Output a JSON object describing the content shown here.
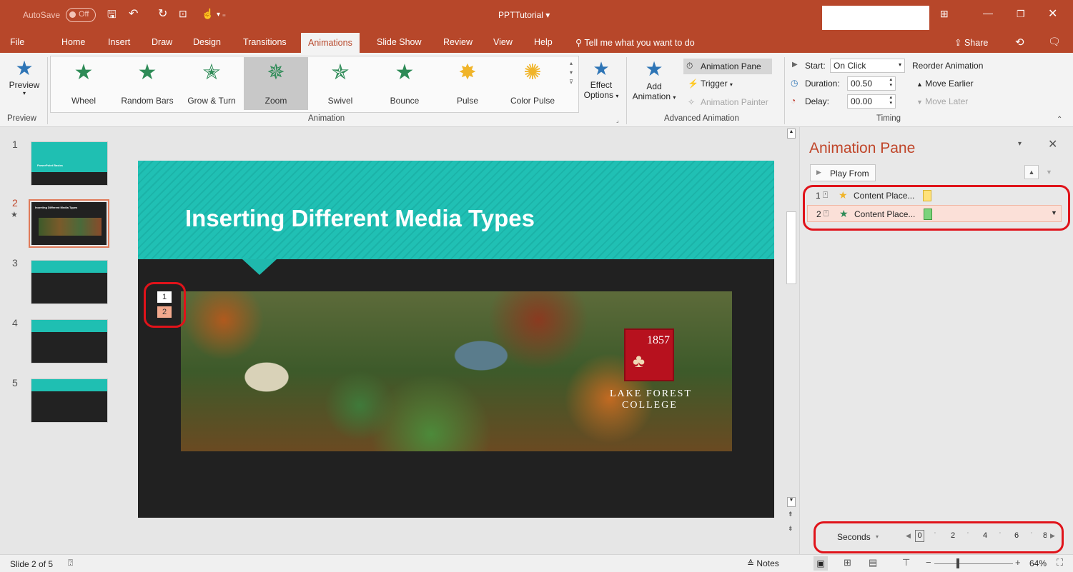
{
  "titlebar": {
    "autosave_label": "AutoSave",
    "autosave_state": "Off",
    "doc_title": "PPTTutorial",
    "title_caret": "▾"
  },
  "tabs": [
    "File",
    "Home",
    "Insert",
    "Draw",
    "Design",
    "Transitions",
    "Animations",
    "Slide Show",
    "Review",
    "View",
    "Help"
  ],
  "tell_me": "Tell me what you want to do",
  "share_label": "Share",
  "ribbon": {
    "preview_label": "Preview",
    "preview_group": "Preview",
    "animation_group": "Animation",
    "animations": [
      {
        "label": "Wheel",
        "color": "#2e75b6"
      },
      {
        "label": "Random Bars",
        "color": "#2e8b57"
      },
      {
        "label": "Grow & Turn",
        "color": "#2e8b57"
      },
      {
        "label": "Zoom",
        "color": "#2e8b57"
      },
      {
        "label": "Swivel",
        "color": "#2e8b57"
      },
      {
        "label": "Bounce",
        "color": "#2e8b57"
      },
      {
        "label": "Pulse",
        "color": "#f0b429"
      },
      {
        "label": "Color Pulse",
        "color": "#f0b429"
      }
    ],
    "effect_options_1": "Effect",
    "effect_options_2": "Options",
    "add_animation_1": "Add",
    "add_animation_2": "Animation",
    "advanced_group": "Advanced Animation",
    "animation_pane": "Animation Pane",
    "trigger": "Trigger",
    "animation_painter": "Animation Painter",
    "start_label": "Start:",
    "start_value": "On Click",
    "duration_label": "Duration:",
    "duration_value": "00.50",
    "delay_label": "Delay:",
    "delay_value": "00.00",
    "timing_group": "Timing",
    "reorder_label": "Reorder Animation",
    "move_earlier": "Move Earlier",
    "move_later": "Move Later"
  },
  "thumbnails": [
    {
      "num": "1",
      "caption": "PowerPoint Basics"
    },
    {
      "num": "2",
      "caption": "Inserting Different Media Types"
    },
    {
      "num": "3",
      "caption": ""
    },
    {
      "num": "4",
      "caption": ""
    },
    {
      "num": "5",
      "caption": ""
    }
  ],
  "slide": {
    "title": "Inserting Different Media Types",
    "tag1": "1",
    "tag2": "2",
    "logo_year": "1857",
    "logo_line1": "LAKE FOREST",
    "logo_line2": "COLLEGE"
  },
  "pane": {
    "title": "Animation Pane",
    "play_from": "Play From",
    "items": [
      {
        "num": "1",
        "label": "Content Place...",
        "star_color": "#f0b429",
        "bar_color": "#ffe27a"
      },
      {
        "num": "2",
        "label": "Content Place...",
        "star_color": "#2e8b57",
        "bar_color": "#7bd37b"
      }
    ],
    "seconds_label": "Seconds",
    "timeline": [
      "0",
      "2",
      "4",
      "6",
      "8"
    ]
  },
  "status": {
    "slide_info": "Slide 2 of 5",
    "notes": "Notes",
    "zoom": "64%"
  }
}
